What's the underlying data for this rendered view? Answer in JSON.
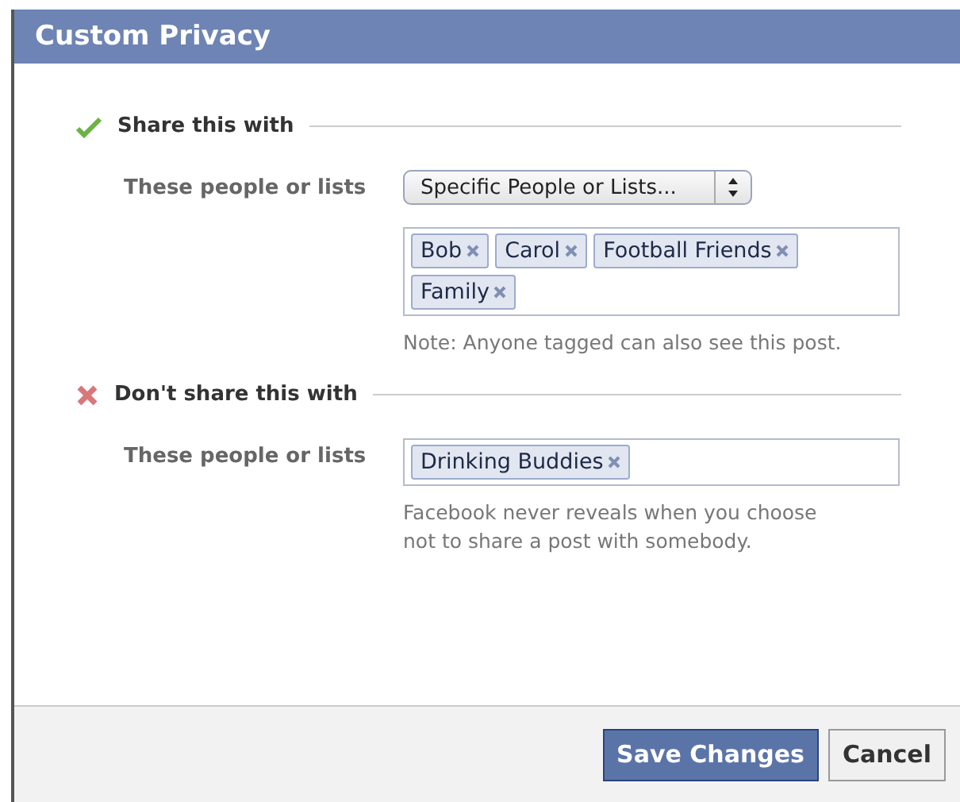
{
  "dialog": {
    "title": "Custom Privacy"
  },
  "sections": [
    {
      "kind": "share",
      "heading": "Share this with",
      "label": "These people or lists",
      "select": {
        "value": "Specific People or Lists..."
      },
      "tokens": [
        "Bob",
        "Carol",
        "Football Friends",
        "Family"
      ],
      "note": "Note: Anyone tagged can also see this post."
    },
    {
      "kind": "dont_share",
      "heading": "Don't share this with",
      "label": "These people or lists",
      "tokens": [
        "Drinking Buddies"
      ],
      "note": "Facebook never reveals when you choose not to share a post with somebody."
    }
  ],
  "buttons": [
    {
      "label": "Save Changes",
      "kind": "primary"
    },
    {
      "label": "Cancel",
      "kind": "secondary"
    }
  ]
}
